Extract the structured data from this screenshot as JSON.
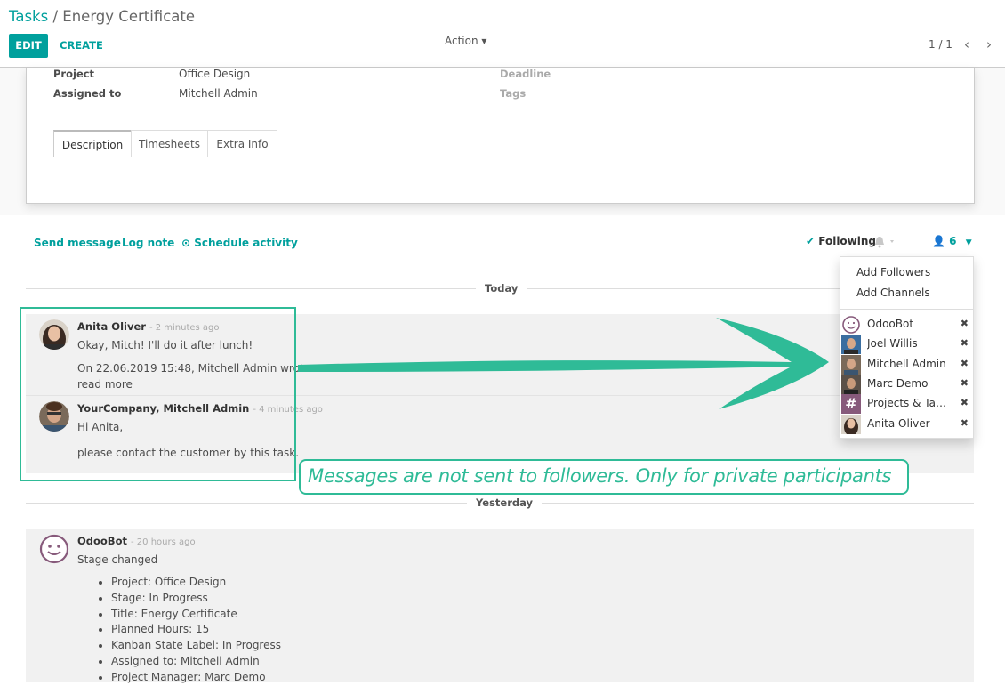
{
  "breadcrumb": {
    "root": "Tasks",
    "separator": "/",
    "current": "Energy Certificate"
  },
  "toolbar": {
    "edit": "EDIT",
    "create": "CREATE",
    "action": "Action ▾",
    "pager": "1 / 1",
    "prev_icon": "‹",
    "next_icon": "›"
  },
  "form": {
    "project_label": "Project",
    "project_value": "Office Design",
    "assigned_label": "Assigned to",
    "assigned_value": "Mitchell Admin",
    "deadline_label": "Deadline",
    "tags_label": "Tags",
    "tabs": [
      "Description",
      "Timesheets",
      "Extra Info"
    ]
  },
  "chatter": {
    "send_message": "Send message",
    "log_note": "Log note",
    "schedule_activity": "Schedule activity",
    "following": "Following",
    "follower_count": "6",
    "today": "Today",
    "yesterday": "Yesterday"
  },
  "messages": [
    {
      "author": "Anita Oliver",
      "ago": "- 2 minutes ago",
      "line1": "Okay, Mitch! I'll do it after lunch!",
      "line2": "On 22.06.2019 15:48, Mitchell Admin wrote:",
      "read_more": "read more"
    },
    {
      "author": "YourCompany, Mitchell Admin",
      "ago": "- 4 minutes ago",
      "line1": "Hi Anita,",
      "line2": "please contact the customer by this task."
    },
    {
      "author": "OdooBot",
      "ago": "- 20 hours ago",
      "line1": "Stage changed"
    }
  ],
  "changes": [
    "Project: Office Design",
    "Stage: In Progress",
    "Title: Energy Certificate",
    "Planned Hours: 15",
    "Kanban State Label: In Progress",
    "Assigned to: Mitchell Admin",
    "Project Manager: Marc Demo"
  ],
  "followers_menu": {
    "add_followers": "Add Followers",
    "add_channels": "Add Channels",
    "followers": [
      "OdooBot",
      "Joel Willis",
      "Mitchell Admin",
      "Marc Demo",
      "Projects & Tas…",
      "Anita Oliver"
    ],
    "remove_icon": "✖"
  },
  "annotation": {
    "callout": "Messages are not sent to followers. Only for private participants"
  },
  "colors": {
    "accent": "#00a09d",
    "annotation": "#2fbb97"
  }
}
